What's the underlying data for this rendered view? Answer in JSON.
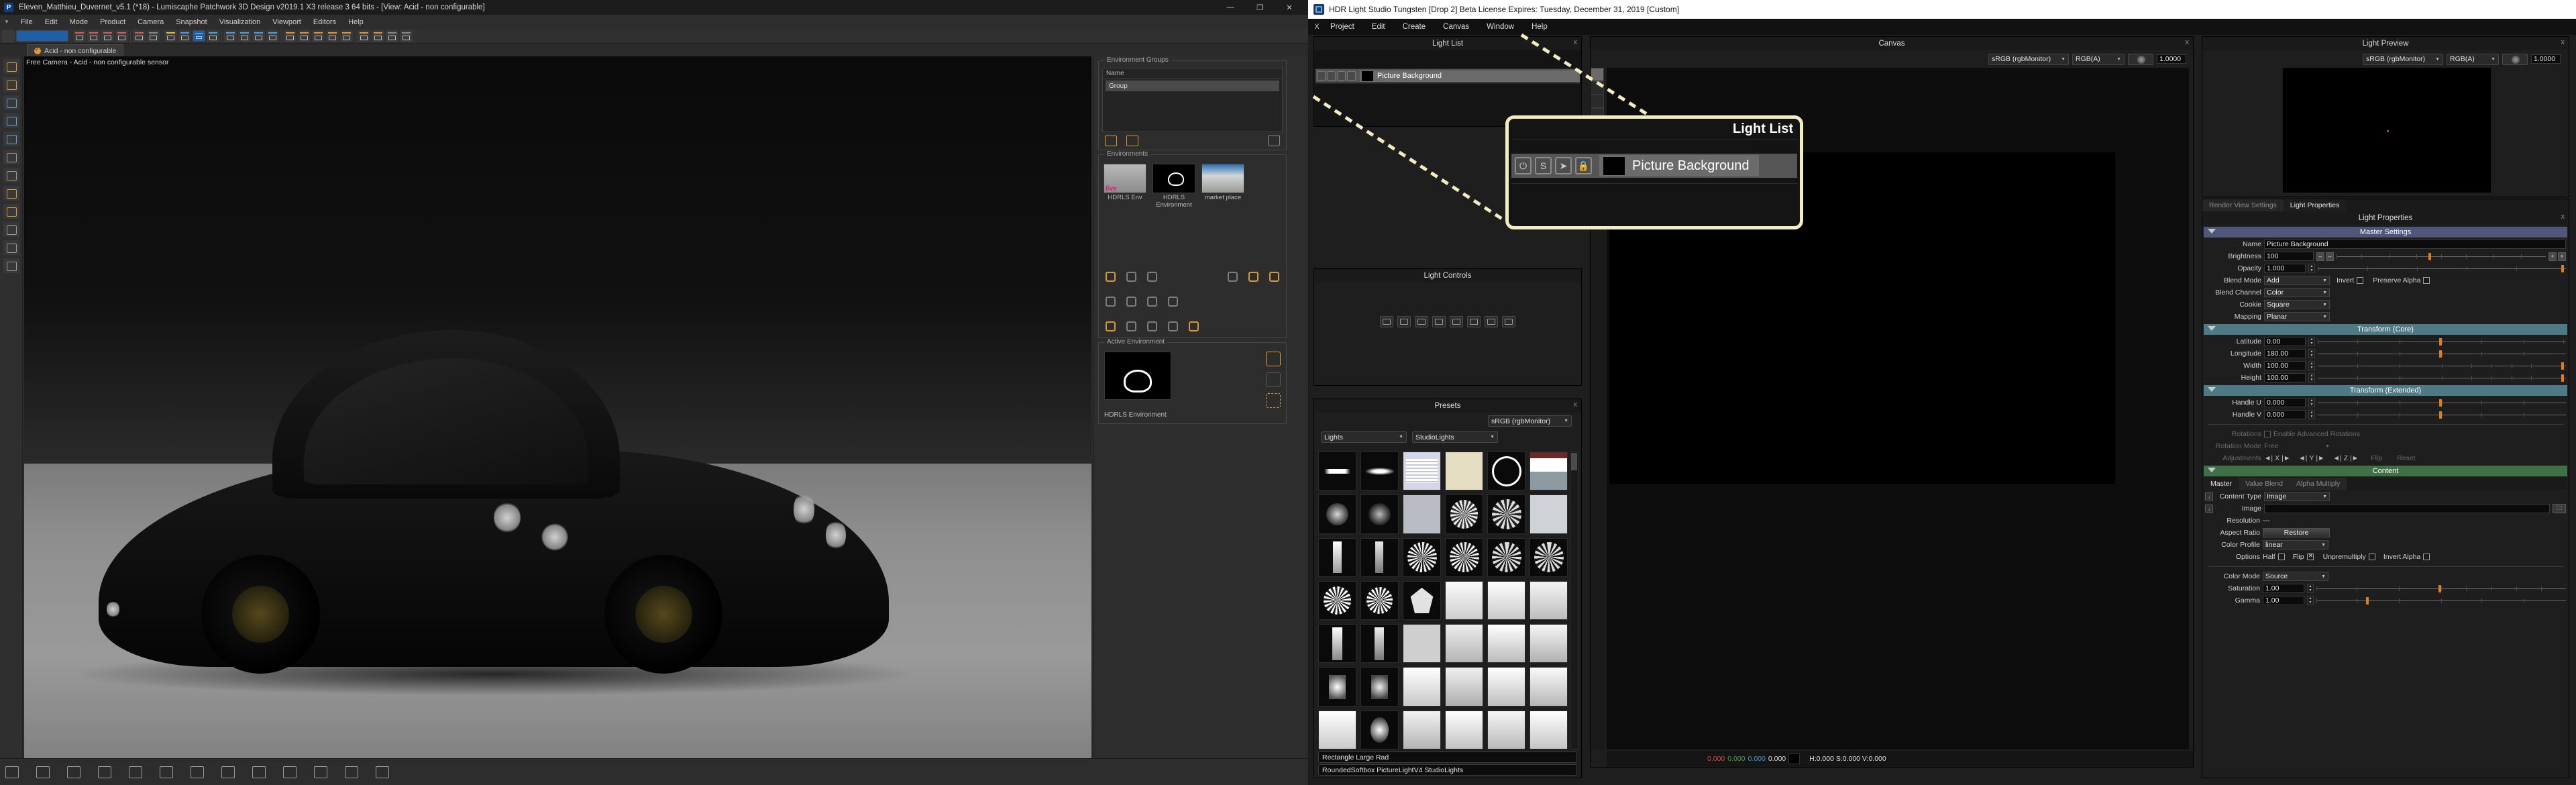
{
  "patchwork": {
    "title": "Eleven_Matthieu_Duvernet_v5.1 (*18) - Lumiscaphe Patchwork 3D Design v2019.1 X3 release 3  64 bits - [View: Acid - non configurable]",
    "logo": "P",
    "window_buttons": [
      "—",
      "❐",
      "✕"
    ],
    "menu": [
      "File",
      "Edit",
      "Mode",
      "Product",
      "Camera",
      "Snapshot",
      "Visualization",
      "Viewport",
      "Editors",
      "Help"
    ],
    "tab": "Acid - non configurable",
    "viewport_label": "Free Camera - Acid - non configurable sensor",
    "environment_groups": {
      "caption": "Environment Groups",
      "header": "Name",
      "rows": [
        "Group"
      ]
    },
    "environments": {
      "caption": "Environments",
      "items": [
        {
          "label": "HDRLS Env"
        },
        {
          "label": "HDRLS Environment"
        },
        {
          "label": "market place"
        }
      ]
    },
    "active_environment": {
      "caption": "Active Environment",
      "name": "HDRLS Environment"
    }
  },
  "hls": {
    "title": "HDR Light Studio Tungsten [Drop 2] Beta License Expires: Tuesday, December 31, 2019  [Custom]",
    "menu": [
      "Project",
      "Edit",
      "Create",
      "Canvas",
      "Window",
      "Help"
    ],
    "close_glyph": "X",
    "light_list": {
      "title": "Light List",
      "close": "x",
      "row": {
        "name": "Picture Background",
        "buttons": [
          "power-icon",
          "solo-icon",
          "select-icon",
          "lock-icon"
        ]
      }
    },
    "light_controls": {
      "title": "Light Controls"
    },
    "presets": {
      "title": "Presets",
      "close": "x",
      "colorspace": "sRGB (rgbMonitor)",
      "category": "Lights",
      "subcategory": "StudioLights",
      "selected_name": "Rectangle Large Rad",
      "path_name": "RoundedSoftbox PictureLightV4 StudioLights"
    },
    "canvas": {
      "title": "Canvas",
      "close": "x",
      "colorspace": "sRGB (rgbMonitor)",
      "channel": "RGB(A)",
      "exposure": "1.0000",
      "status": {
        "r": "0.000",
        "g": "0.000",
        "b": "0.000",
        "a": "0.000",
        "hsv": "H:0.000 S:0.000 V:0.000"
      }
    },
    "light_preview": {
      "title": "Light Preview",
      "close": "x",
      "colorspace": "sRGB (rgbMonitor)",
      "channel": "RGB(A)",
      "exposure": "1.0000"
    },
    "light_properties": {
      "tabs": [
        {
          "label": "Render View Settings",
          "active": false
        },
        {
          "label": "Light Properties",
          "active": true
        }
      ],
      "title": "Light Properties",
      "close": "x",
      "sections": {
        "master": "Master Settings",
        "transform_core": "Transform (Core)",
        "transform_ext": "Transform (Extended)",
        "content": "Content"
      },
      "master": {
        "name_label": "Name",
        "name_value": "Picture Background",
        "brightness_label": "Brightness",
        "brightness_value": "100",
        "opacity_label": "Opacity",
        "opacity_value": "1.000",
        "blend_mode_label": "Blend Mode",
        "blend_mode_value": "Add",
        "invert_label": "Invert",
        "preserve_alpha_label": "Preserve Alpha",
        "blend_channel_label": "Blend Channel",
        "blend_channel_value": "Color",
        "cookie_label": "Cookie",
        "cookie_value": "Square",
        "mapping_label": "Mapping",
        "mapping_value": "Planar"
      },
      "transform_core": {
        "latitude_label": "Latitude",
        "latitude_value": "0.00",
        "longitude_label": "Longitude",
        "longitude_value": "180.00",
        "width_label": "Width",
        "width_value": "100.00",
        "height_label": "Height",
        "height_value": "100.00"
      },
      "transform_ext": {
        "handle_u_label": "Handle U",
        "handle_u_value": "0.000",
        "handle_v_label": "Handle V",
        "handle_v_value": "0.000",
        "rotations_label": "Rotations",
        "advanced_rotations_label": "Enable Advanced Rotations",
        "rotation_mode_label": "Rotation Mode",
        "rotation_mode_value": "Free",
        "adjustments_label": "Adjustments",
        "axes": [
          "X",
          "Y",
          "Z"
        ],
        "flip_label": "Flip",
        "reset_label": "Reset"
      },
      "content": {
        "tabs": [
          {
            "label": "Master",
            "active": true
          },
          {
            "label": "Value Blend",
            "active": false
          },
          {
            "label": "Alpha Multiply",
            "active": false
          }
        ],
        "content_type_label": "Content Type",
        "content_type_value": "Image",
        "image_label": "Image",
        "image_value": "",
        "resolution_label": "Resolution",
        "resolution_value": "---",
        "aspect_ratio_label": "Aspect Ratio",
        "restore_label": "Restore",
        "color_profile_label": "Color Profile",
        "color_profile_value": "linear",
        "options_label": "Options",
        "options": [
          {
            "label": "Half",
            "checked": false
          },
          {
            "label": "Flip",
            "checked": true
          },
          {
            "label": "Unpremultiply",
            "checked": false
          },
          {
            "label": "Invert Alpha",
            "checked": false
          }
        ],
        "color_mode_label": "Color Mode",
        "color_mode_value": "Source",
        "saturation_label": "Saturation",
        "saturation_value": "1.00",
        "gamma_label": "Gamma",
        "gamma_value": "1.00"
      }
    }
  },
  "annotation": {
    "magnifier_title": "Light List",
    "magnifier_row_name": "Picture Background",
    "highlight_color": "#f2ecc0",
    "marker_color": "#f60505"
  }
}
